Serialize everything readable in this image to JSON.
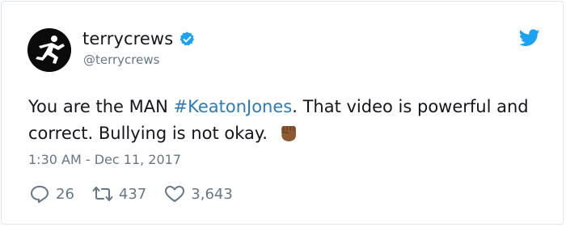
{
  "user": {
    "display_name": "terrycrews",
    "handle": "@terrycrews",
    "avatar_icon": "runner-silhouette-avatar",
    "verified_icon": "verified-badge-icon"
  },
  "tweet": {
    "text_before": "You are the MAN ",
    "hashtag": "#KeatonJones",
    "text_after": ". That video is powerful and correct. Bullying is not okay.",
    "emoji": "raised-fist-medium-dark-skin",
    "timestamp": "1:30 AM - Dec 11, 2017"
  },
  "actions": {
    "replies": "26",
    "retweets": "437",
    "likes": "3,643"
  },
  "colors": {
    "text": "#14171a",
    "muted": "#657786",
    "link": "#2b7bb9",
    "twitter_blue": "#1da1f2",
    "border": "#e1e8ed"
  }
}
